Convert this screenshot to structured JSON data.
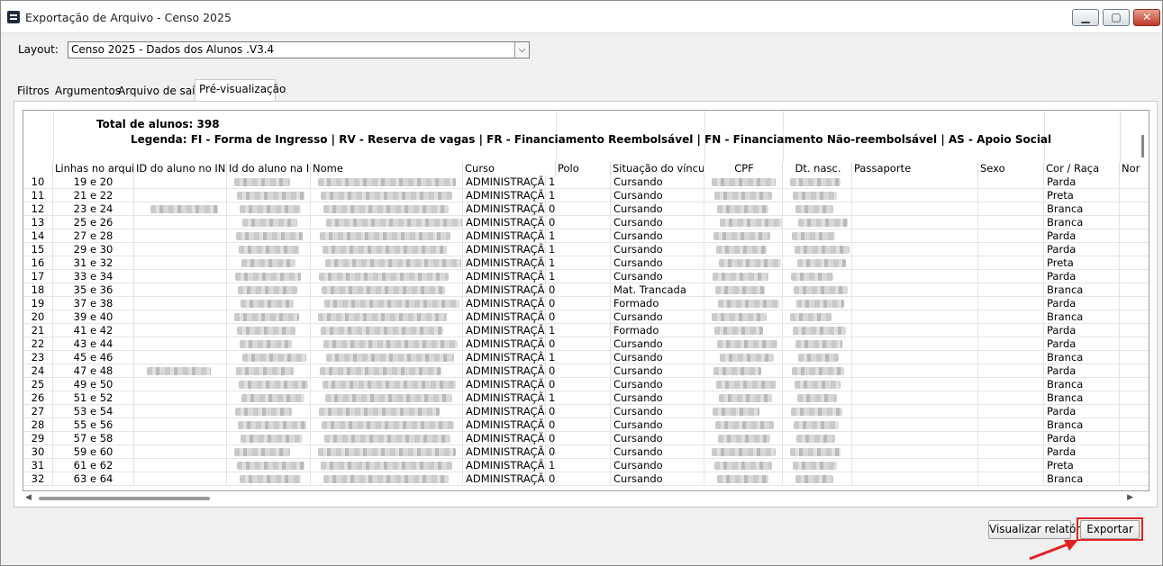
{
  "window": {
    "title": "Exportação de Arquivo - Censo 2025",
    "controls": [
      "minimize",
      "maximize",
      "close"
    ]
  },
  "layout": {
    "label": "Layout:",
    "selected": "Censo 2025 - Dados dos Alunos .V3.4"
  },
  "tabs": [
    {
      "label": "Filtros",
      "active": false
    },
    {
      "label": "Argumentos",
      "active": false
    },
    {
      "label": "Arquivo de saída",
      "active": false
    },
    {
      "label": "Pré-visualização",
      "active": true
    }
  ],
  "preview": {
    "total": "Total de alunos: 398",
    "legend": "Legenda:  FI - Forma de Ingresso | RV - Reserva de vagas | FR - Financiamento Reembolsável | FN - Financiamento Não-reembolsável | AS - Apoio Social",
    "columns": [
      "",
      "Linhas no arquivo",
      "ID do aluno no INEP",
      "Id do aluno na IES",
      "Nome",
      "Curso",
      "Polo",
      "Situação do vínculo",
      "CPF",
      "Dt. nasc.",
      "Passaporte",
      "Sexo",
      "Cor / Raça",
      "Nor"
    ],
    "rows": [
      {
        "n": "10",
        "linhas": "19 e 20",
        "curso": "ADMINISTRAÇÃO-BA",
        "polo": "1",
        "situacao": "Cursando",
        "cor": "Parda"
      },
      {
        "n": "11",
        "linhas": "21 e 22",
        "curso": "ADMINISTRAÇÃO-BA",
        "polo": "1",
        "situacao": "Cursando",
        "cor": "Preta"
      },
      {
        "n": "12",
        "linhas": "23 e 24",
        "curso": "ADMINISTRAÇÃO-BA",
        "polo": "0",
        "situacao": "Cursando",
        "cor": "Branca"
      },
      {
        "n": "13",
        "linhas": "25 e 26",
        "curso": "ADMINISTRAÇÃO-BA",
        "polo": "0",
        "situacao": "Cursando",
        "cor": "Branca"
      },
      {
        "n": "14",
        "linhas": "27 e 28",
        "curso": "ADMINISTRAÇÃO-BA",
        "polo": "1",
        "situacao": "Cursando",
        "cor": "Parda"
      },
      {
        "n": "15",
        "linhas": "29 e 30",
        "curso": "ADMINISTRAÇÃO-BA",
        "polo": "1",
        "situacao": "Cursando",
        "cor": "Parda"
      },
      {
        "n": "16",
        "linhas": "31 e 32",
        "curso": "ADMINISTRAÇÃO-BA",
        "polo": "1",
        "situacao": "Cursando",
        "cor": "Preta"
      },
      {
        "n": "17",
        "linhas": "33 e 34",
        "curso": "ADMINISTRAÇÃO-BA",
        "polo": "1",
        "situacao": "Cursando",
        "cor": "Parda"
      },
      {
        "n": "18",
        "linhas": "35 e 36",
        "curso": "ADMINISTRAÇÃO-BA",
        "polo": "0",
        "situacao": "Mat. Trancada",
        "cor": "Branca"
      },
      {
        "n": "19",
        "linhas": "37 e 38",
        "curso": "ADMINISTRAÇÃO-BA",
        "polo": "0",
        "situacao": "Formado",
        "cor": "Parda"
      },
      {
        "n": "20",
        "linhas": "39 e 40",
        "curso": "ADMINISTRAÇÃO-BA",
        "polo": "0",
        "situacao": "Cursando",
        "cor": "Branca"
      },
      {
        "n": "21",
        "linhas": "41 e 42",
        "curso": "ADMINISTRAÇÃO-BA",
        "polo": "1",
        "situacao": "Formado",
        "cor": "Parda"
      },
      {
        "n": "22",
        "linhas": "43 e 44",
        "curso": "ADMINISTRAÇÃO-BA",
        "polo": "0",
        "situacao": "Cursando",
        "cor": "Parda"
      },
      {
        "n": "23",
        "linhas": "45 e 46",
        "curso": "ADMINISTRAÇÃO-BA",
        "polo": "1",
        "situacao": "Cursando",
        "cor": "Branca"
      },
      {
        "n": "24",
        "linhas": "47 e 48",
        "curso": "ADMINISTRAÇÃO-BA",
        "polo": "0",
        "situacao": "Cursando",
        "cor": "Parda"
      },
      {
        "n": "25",
        "linhas": "49 e 50",
        "curso": "ADMINISTRAÇÃO-BA",
        "polo": "0",
        "situacao": "Cursando",
        "cor": "Branca"
      },
      {
        "n": "26",
        "linhas": "51 e 52",
        "curso": "ADMINISTRAÇÃO-BA",
        "polo": "1",
        "situacao": "Cursando",
        "cor": "Branca"
      },
      {
        "n": "27",
        "linhas": "53 e 54",
        "curso": "ADMINISTRAÇÃO-BA",
        "polo": "0",
        "situacao": "Cursando",
        "cor": "Parda"
      },
      {
        "n": "28",
        "linhas": "55 e 56",
        "curso": "ADMINISTRAÇÃO-BA",
        "polo": "0",
        "situacao": "Cursando",
        "cor": "Branca"
      },
      {
        "n": "29",
        "linhas": "57 e 58",
        "curso": "ADMINISTRAÇÃO-BA",
        "polo": "0",
        "situacao": "Cursando",
        "cor": "Parda"
      },
      {
        "n": "30",
        "linhas": "59 e 60",
        "curso": "ADMINISTRAÇÃO-BA",
        "polo": "0",
        "situacao": "Cursando",
        "cor": "Parda"
      },
      {
        "n": "31",
        "linhas": "61 e 62",
        "curso": "ADMINISTRAÇÃO-BA",
        "polo": "1",
        "situacao": "Cursando",
        "cor": "Preta"
      },
      {
        "n": "32",
        "linhas": "63 e 64",
        "curso": "ADMINISTRAÇÃO-BA",
        "polo": "0",
        "situacao": "Cursando",
        "cor": "Branca"
      }
    ]
  },
  "buttons": {
    "report": "Visualizar relatório",
    "export": "Exportar"
  },
  "colors": {
    "highlight": "#e02222",
    "window_bg": "#f0f0f0"
  }
}
